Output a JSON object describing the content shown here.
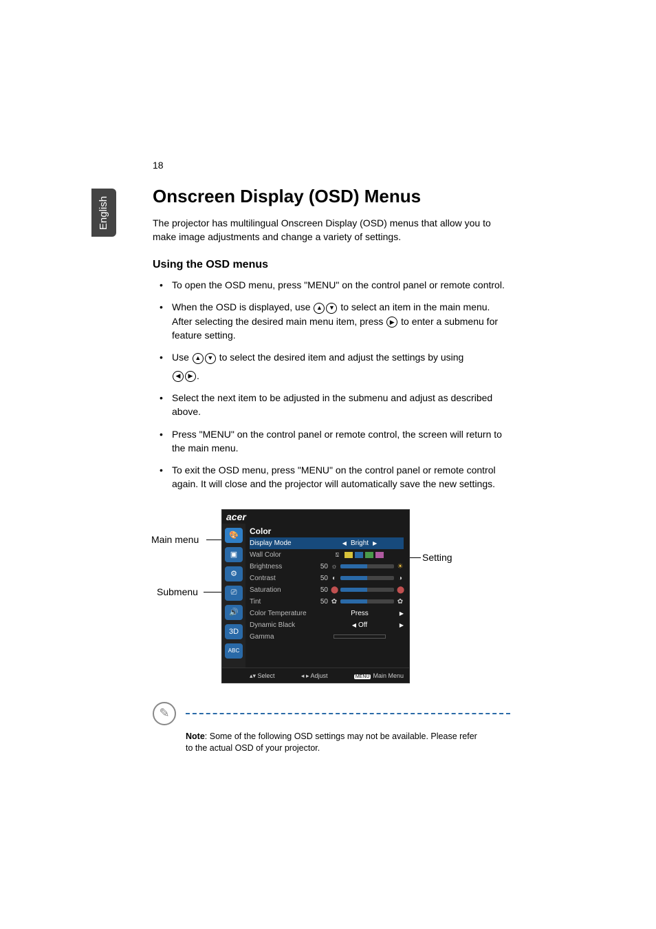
{
  "page_number": "18",
  "language_tab": "English",
  "heading": "Onscreen Display (OSD) Menus",
  "intro": "The projector has multilingual Onscreen Display (OSD) menus that allow you to make image adjustments and change a variety of settings.",
  "subheading": "Using the OSD menus",
  "bullets": {
    "b1": "To open the OSD menu, press \"MENU\" on the control panel or remote control.",
    "b2a": "When the OSD is displayed, use ",
    "b2b": " to select an item in the main menu. After selecting the desired main menu item, press ",
    "b2c": " to enter a submenu for feature setting.",
    "b3a": "Use ",
    "b3b": " to select the desired item and adjust the settings by using ",
    "b3c": ".",
    "b4": "Select the next item to be adjusted in the submenu and adjust as described above.",
    "b5": "Press \"MENU\" on the control panel or remote control, the screen will return to the main menu.",
    "b6": "To exit the OSD menu, press \"MENU\" on the control panel or remote control again. It will close and the projector will automatically save the new settings."
  },
  "callouts": {
    "main_menu": "Main menu",
    "submenu": "Submenu",
    "setting": "Setting"
  },
  "osd": {
    "logo": "acer",
    "title": "Color",
    "rows": {
      "display_mode": {
        "label": "Display Mode",
        "value": "Bright"
      },
      "wall_color": {
        "label": "Wall Color"
      },
      "brightness": {
        "label": "Brightness",
        "num": "50"
      },
      "contrast": {
        "label": "Contrast",
        "num": "50"
      },
      "saturation": {
        "label": "Saturation",
        "num": "50"
      },
      "tint": {
        "label": "Tint",
        "num": "50"
      },
      "color_temp": {
        "label": "Color Temperature",
        "value": "Press"
      },
      "dyn_black": {
        "label": "Dynamic Black",
        "value": "Off"
      },
      "gamma": {
        "label": "Gamma"
      }
    },
    "footer": {
      "select": "Select",
      "adjust": "Adjust",
      "menu_badge": "MENU",
      "main_menu": "Main Menu"
    }
  },
  "note": {
    "label": "Note",
    "text": ": Some of the following OSD settings may not be available. Please refer to the actual OSD of your projector."
  }
}
